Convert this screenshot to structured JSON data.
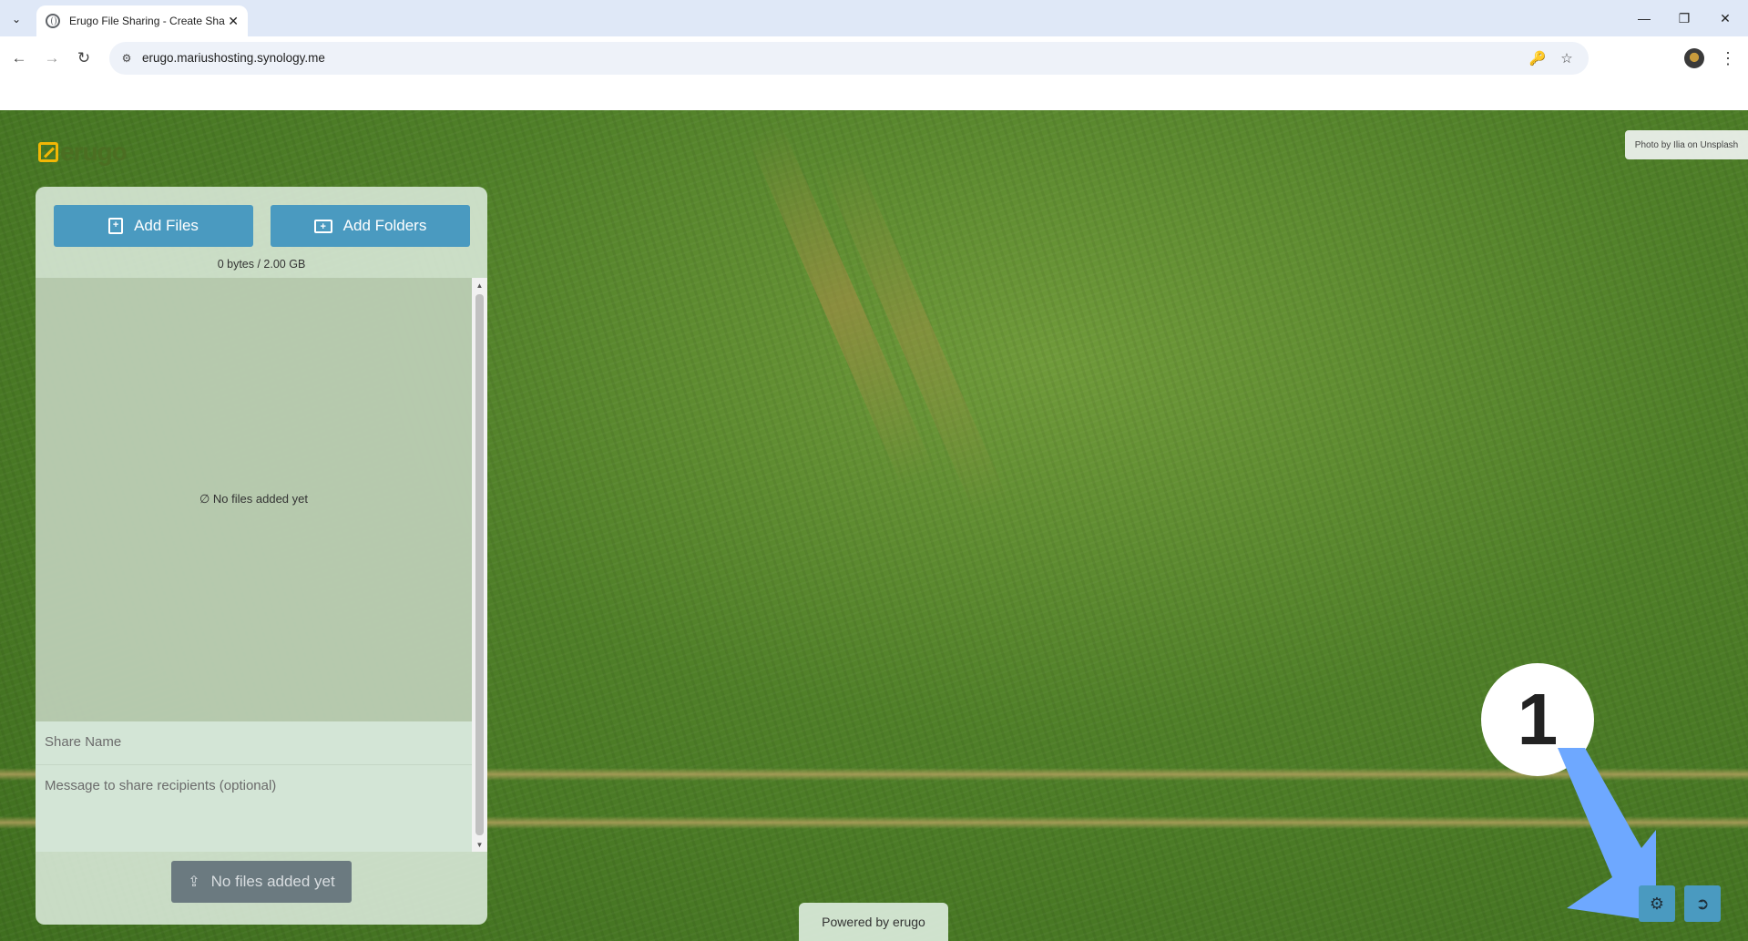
{
  "browser": {
    "tab_title": "Erugo File Sharing - Create Sha",
    "url": "erugo.mariushosting.synology.me",
    "tab_menu_icon": "chevron-down-icon",
    "window_controls": [
      "minimize-icon",
      "restore-icon",
      "close-icon"
    ]
  },
  "page": {
    "logo_text": "erugo",
    "photo_credit": "Photo by Ilia on Unsplash",
    "panel": {
      "add_files_label": "Add Files",
      "add_folders_label": "Add Folders",
      "usage": "0 bytes / 2.00 GB",
      "empty_message": "No files added yet",
      "share_name_placeholder": "Share Name",
      "message_placeholder": "Message to share recipients (optional)",
      "share_button_label": "No files added yet"
    },
    "powered_by": "Powered by erugo",
    "settings_icon": "gear-icon",
    "logout_icon": "logout-icon"
  },
  "annotation": {
    "step_number": "1"
  },
  "colors": {
    "button_blue": "#4a9ac0",
    "logo_yellow": "#f2b705",
    "annotation_arrow": "#6ea8ff"
  }
}
